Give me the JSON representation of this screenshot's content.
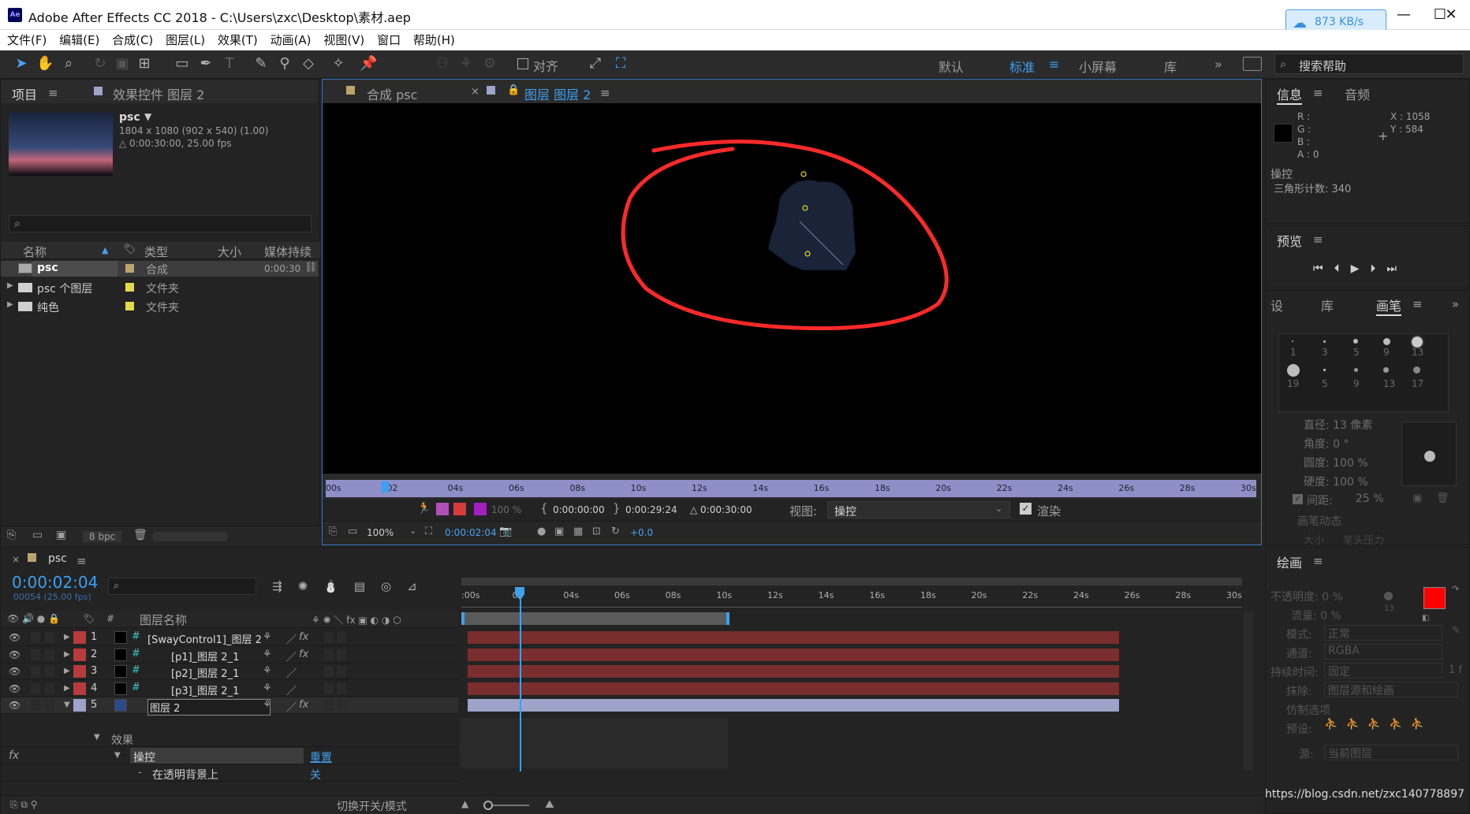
{
  "window": {
    "title": "Adobe After Effects CC 2018 - C:\\Users\\zxc\\Desktop\\素材.aep",
    "speed": "873 KB/s"
  },
  "menu": [
    "文件(F)",
    "编辑(E)",
    "合成(C)",
    "图层(L)",
    "效果(T)",
    "动画(A)",
    "视图(V)",
    "窗口",
    "帮助(H)"
  ],
  "toolbar": {
    "align_label": "对齐",
    "workspaces": [
      "默认",
      "标准",
      "小屏幕",
      "库"
    ],
    "active_workspace": "标准",
    "search_placeholder": "搜索帮助"
  },
  "project": {
    "tab_project": "项目",
    "tab_effects": "效果控件 图层 2",
    "item_name": "psc",
    "item_dims": "1804 x 1080  (902 x 540) (1.00)",
    "item_duration": "△ 0:00:30:00, 25.00 fps",
    "columns": [
      "名称",
      "类型",
      "大小",
      "媒体持续"
    ],
    "rows": [
      {
        "name": "psc",
        "type": "合成",
        "duration": "0:00:30"
      },
      {
        "name": "psc 个图层",
        "type": "文件夹",
        "duration": ""
      },
      {
        "name": "纯色",
        "type": "文件夹",
        "duration": ""
      }
    ],
    "bpc": "8 bpc"
  },
  "viewer": {
    "tab_comp": "合成 psc",
    "tab_layer": "图层 图层 2",
    "ruler": [
      "00s",
      "02",
      "04s",
      "06s",
      "08s",
      "10s",
      "12s",
      "14s",
      "16s",
      "18s",
      "20s",
      "22s",
      "24s",
      "26s",
      "28s",
      "30s"
    ],
    "opacity": "100 %",
    "in_time": "0:00:00:00",
    "out_time": "0:00:29:24",
    "duration": "△ 0:00:30:00",
    "view_label": "视图:",
    "view_value": "操控",
    "render_label": "渲染",
    "zoom": "100%",
    "current_time": "0:00:02:04",
    "exposure": "+0.0"
  },
  "info": {
    "tab_info": "信息",
    "tab_audio": "音频",
    "r": "R :",
    "g": "G :",
    "b": "B :",
    "a": "A : 0",
    "x": "X : 1058",
    "y": "Y : 584",
    "tool_name": "操控",
    "triangles": "三角形计数: 340"
  },
  "preview": {
    "title": "预览"
  },
  "brushes": {
    "tab_settings": "设",
    "tab_library": "库",
    "tab_brush": "画笔",
    "sizes": [
      "1",
      "3",
      "5",
      "9",
      "13",
      "19",
      "5",
      "9",
      "13",
      "17"
    ],
    "diameter": "直径: 13 像素",
    "angle": "角度: 0 °",
    "roundness": "圆度: 100 %",
    "hardness": "硬度: 100 %",
    "spacing": "间距:",
    "spacing_value": "25 %",
    "dynamics": "画笔动态",
    "size_label": "大小",
    "size_value": "笔头压力"
  },
  "paint": {
    "title": "绘画",
    "opacity": "不透明度: 0 %",
    "flow": "流量: 0 %",
    "mode_label": "模式:",
    "mode_value": "正常",
    "channel_label": "通道:",
    "channel_value": "RGBA",
    "duration_label": "持续时间:",
    "duration_value": "固定",
    "frames": "1 f",
    "erase_label": "抹除:",
    "erase_value": "图层源和绘画",
    "clone_title": "仿制选项",
    "preset_label": "预设:",
    "source_label": "源:",
    "source_value": "当前图层",
    "brush_size": "13",
    "fg_color": "#ff0000",
    "bg_color": "#ffffff"
  },
  "timeline": {
    "comp_name": "psc",
    "timecode": "0:00:02:04",
    "frames": "00054 (25.00 fps)",
    "col_number": "#",
    "col_name": "图层名称",
    "ruler": [
      ":00s",
      "02",
      "04s",
      "06s",
      "08s",
      "10s",
      "12s",
      "14s",
      "16s",
      "18s",
      "20s",
      "22s",
      "24s",
      "26s",
      "28s",
      "30s"
    ],
    "layers": [
      {
        "num": "1",
        "name": "[SwayControl1]_图层 2",
        "fx": true
      },
      {
        "num": "2",
        "name": "[p1]_图层 2_1",
        "fx": true
      },
      {
        "num": "3",
        "name": "[p2]_图层 2_1",
        "fx": false
      },
      {
        "num": "4",
        "name": "[p3]_图层 2_1",
        "fx": false
      },
      {
        "num": "5",
        "name": "图层 2",
        "fx": true
      }
    ],
    "effects_label": "效果",
    "effect_name": "操控",
    "reset_label": "重置",
    "option_label": "在透明背景上",
    "option_value": "关",
    "toggle_label": "切换开关/模式"
  },
  "watermark": "https://blog.csdn.net/zxc140778897"
}
